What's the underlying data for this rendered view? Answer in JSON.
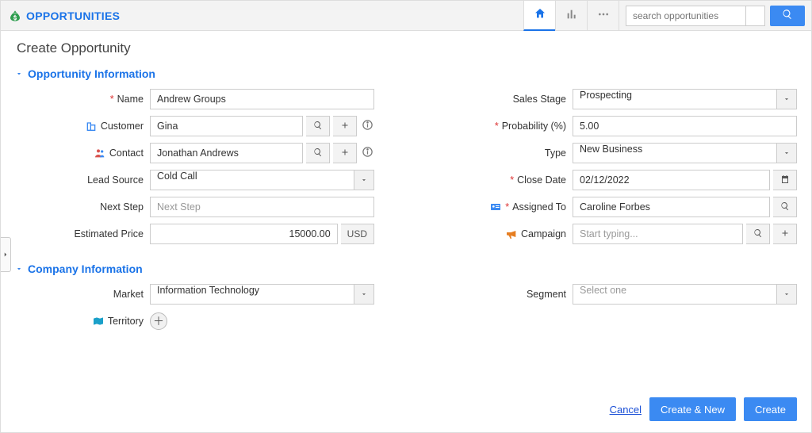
{
  "module": {
    "title": "OPPORTUNITIES"
  },
  "search": {
    "placeholder": "search opportunities"
  },
  "page": {
    "title": "Create Opportunity"
  },
  "sections": {
    "opp_info": "Opportunity Information",
    "company_info": "Company Information"
  },
  "labels": {
    "name": "Name",
    "customer": "Customer",
    "contact": "Contact",
    "lead_source": "Lead Source",
    "next_step": "Next Step",
    "est_price": "Estimated Price",
    "sales_stage": "Sales Stage",
    "probability": "Probability (%)",
    "type": "Type",
    "close_date": "Close Date",
    "assigned_to": "Assigned To",
    "campaign": "Campaign",
    "market": "Market",
    "segment": "Segment",
    "territory": "Territory"
  },
  "values": {
    "name": "Andrew Groups",
    "customer": "Gina",
    "contact": "Jonathan Andrews",
    "lead_source": "Cold Call",
    "next_step_placeholder": "Next Step",
    "est_price": "15000.00",
    "est_price_unit": "USD",
    "sales_stage": "Prospecting",
    "probability": "5.00",
    "type": "New Business",
    "close_date": "02/12/2022",
    "assigned_to": "Caroline Forbes",
    "campaign_placeholder": "Start typing...",
    "market": "Information Technology",
    "segment_placeholder": "Select one"
  },
  "footer": {
    "cancel": "Cancel",
    "create_new": "Create & New",
    "create": "Create"
  }
}
